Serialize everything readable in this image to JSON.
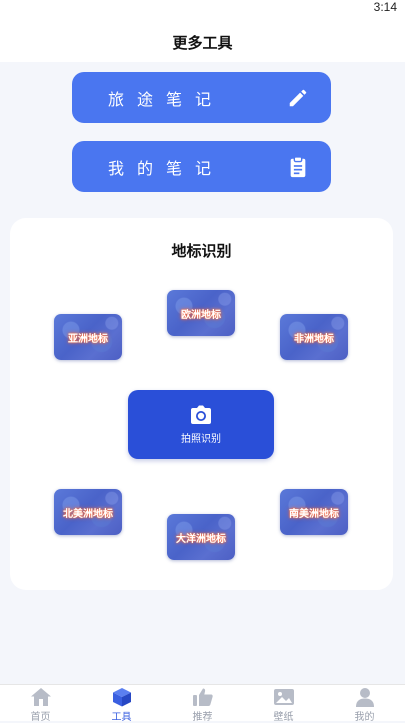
{
  "status": {
    "time": "3:14"
  },
  "header": {
    "title": "更多工具"
  },
  "notes": {
    "travel_label": "旅途笔记",
    "my_label": "我的笔记"
  },
  "landmarks": {
    "title": "地标识别",
    "tiles": {
      "europe": "欧洲地标",
      "asia": "亚洲地标",
      "africa": "非洲地标",
      "north_america": "北美洲地标",
      "south_america": "南美洲地标",
      "oceania": "大洋洲地标"
    },
    "camera_label": "拍照识别"
  },
  "tabbar": {
    "items": [
      {
        "label": "首页",
        "icon": "home-icon"
      },
      {
        "label": "工具",
        "icon": "cube-icon",
        "active": true
      },
      {
        "label": "推荐",
        "icon": "thumbs-up-icon"
      },
      {
        "label": "壁纸",
        "icon": "image-icon"
      },
      {
        "label": "我的",
        "icon": "user-icon"
      }
    ]
  },
  "colors": {
    "accent": "#4a76f0",
    "camera": "#2a4fd8",
    "tab_active": "#3a5fe0",
    "tab_inactive": "#9aa0ad"
  }
}
